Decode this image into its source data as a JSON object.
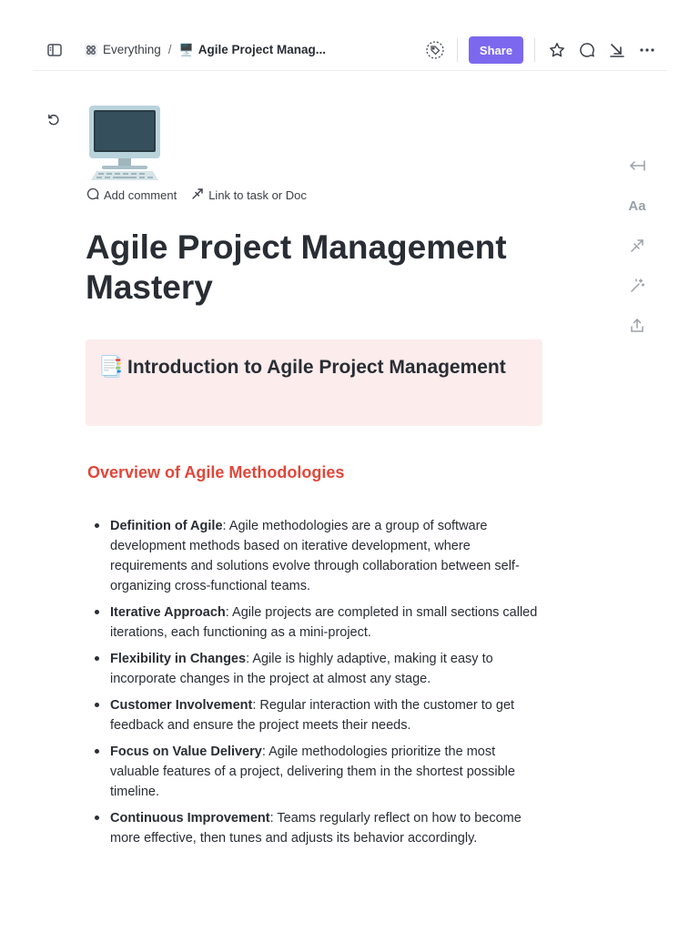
{
  "breadcrumb": {
    "workspace": "Everything",
    "separator": "/",
    "doc_emoji": "🖥️",
    "doc": "Agile Project Manag..."
  },
  "toolbar": {
    "share_label": "Share"
  },
  "doc_actions": {
    "add_comment": "Add comment",
    "link_task": "Link to task or Doc"
  },
  "doc": {
    "icon_emoji": "🖥️",
    "title": "Agile Project Management Mastery",
    "callout": {
      "emoji": "📑",
      "text": "Introduction to Agile Project Management"
    },
    "section_heading": "Overview of Agile Methodologies",
    "bullets": [
      {
        "term": "Definition of Agile",
        "text": ": Agile methodologies are a group of software development methods based on iterative development, where requirements and solutions evolve through collaboration between self-organizing cross-functional teams."
      },
      {
        "term": "Iterative Approach",
        "text": ": Agile projects are completed in small sections called iterations, each functioning as a mini-project."
      },
      {
        "term": "Flexibility in Changes",
        "text": ": Agile is highly adaptive, making it easy to incorporate changes in the project at almost any stage."
      },
      {
        "term": "Customer Involvement",
        "text": ": Regular interaction with the customer to get feedback and ensure the project meets their needs."
      },
      {
        "term": "Focus on Value Delivery",
        "text": ": Agile methodologies prioritize the most valuable features of a project, delivering them in the shortest possible timeline."
      },
      {
        "term": "Continuous Improvement",
        "text": ": Teams regularly reflect on how to become more effective, then tunes and adjusts its behavior accordingly."
      }
    ]
  },
  "side_tools": {
    "font_label": "Aa"
  },
  "colors": {
    "accent": "#7b68ee",
    "heading_red": "#e0473b",
    "callout_bg": "#fcecec"
  }
}
